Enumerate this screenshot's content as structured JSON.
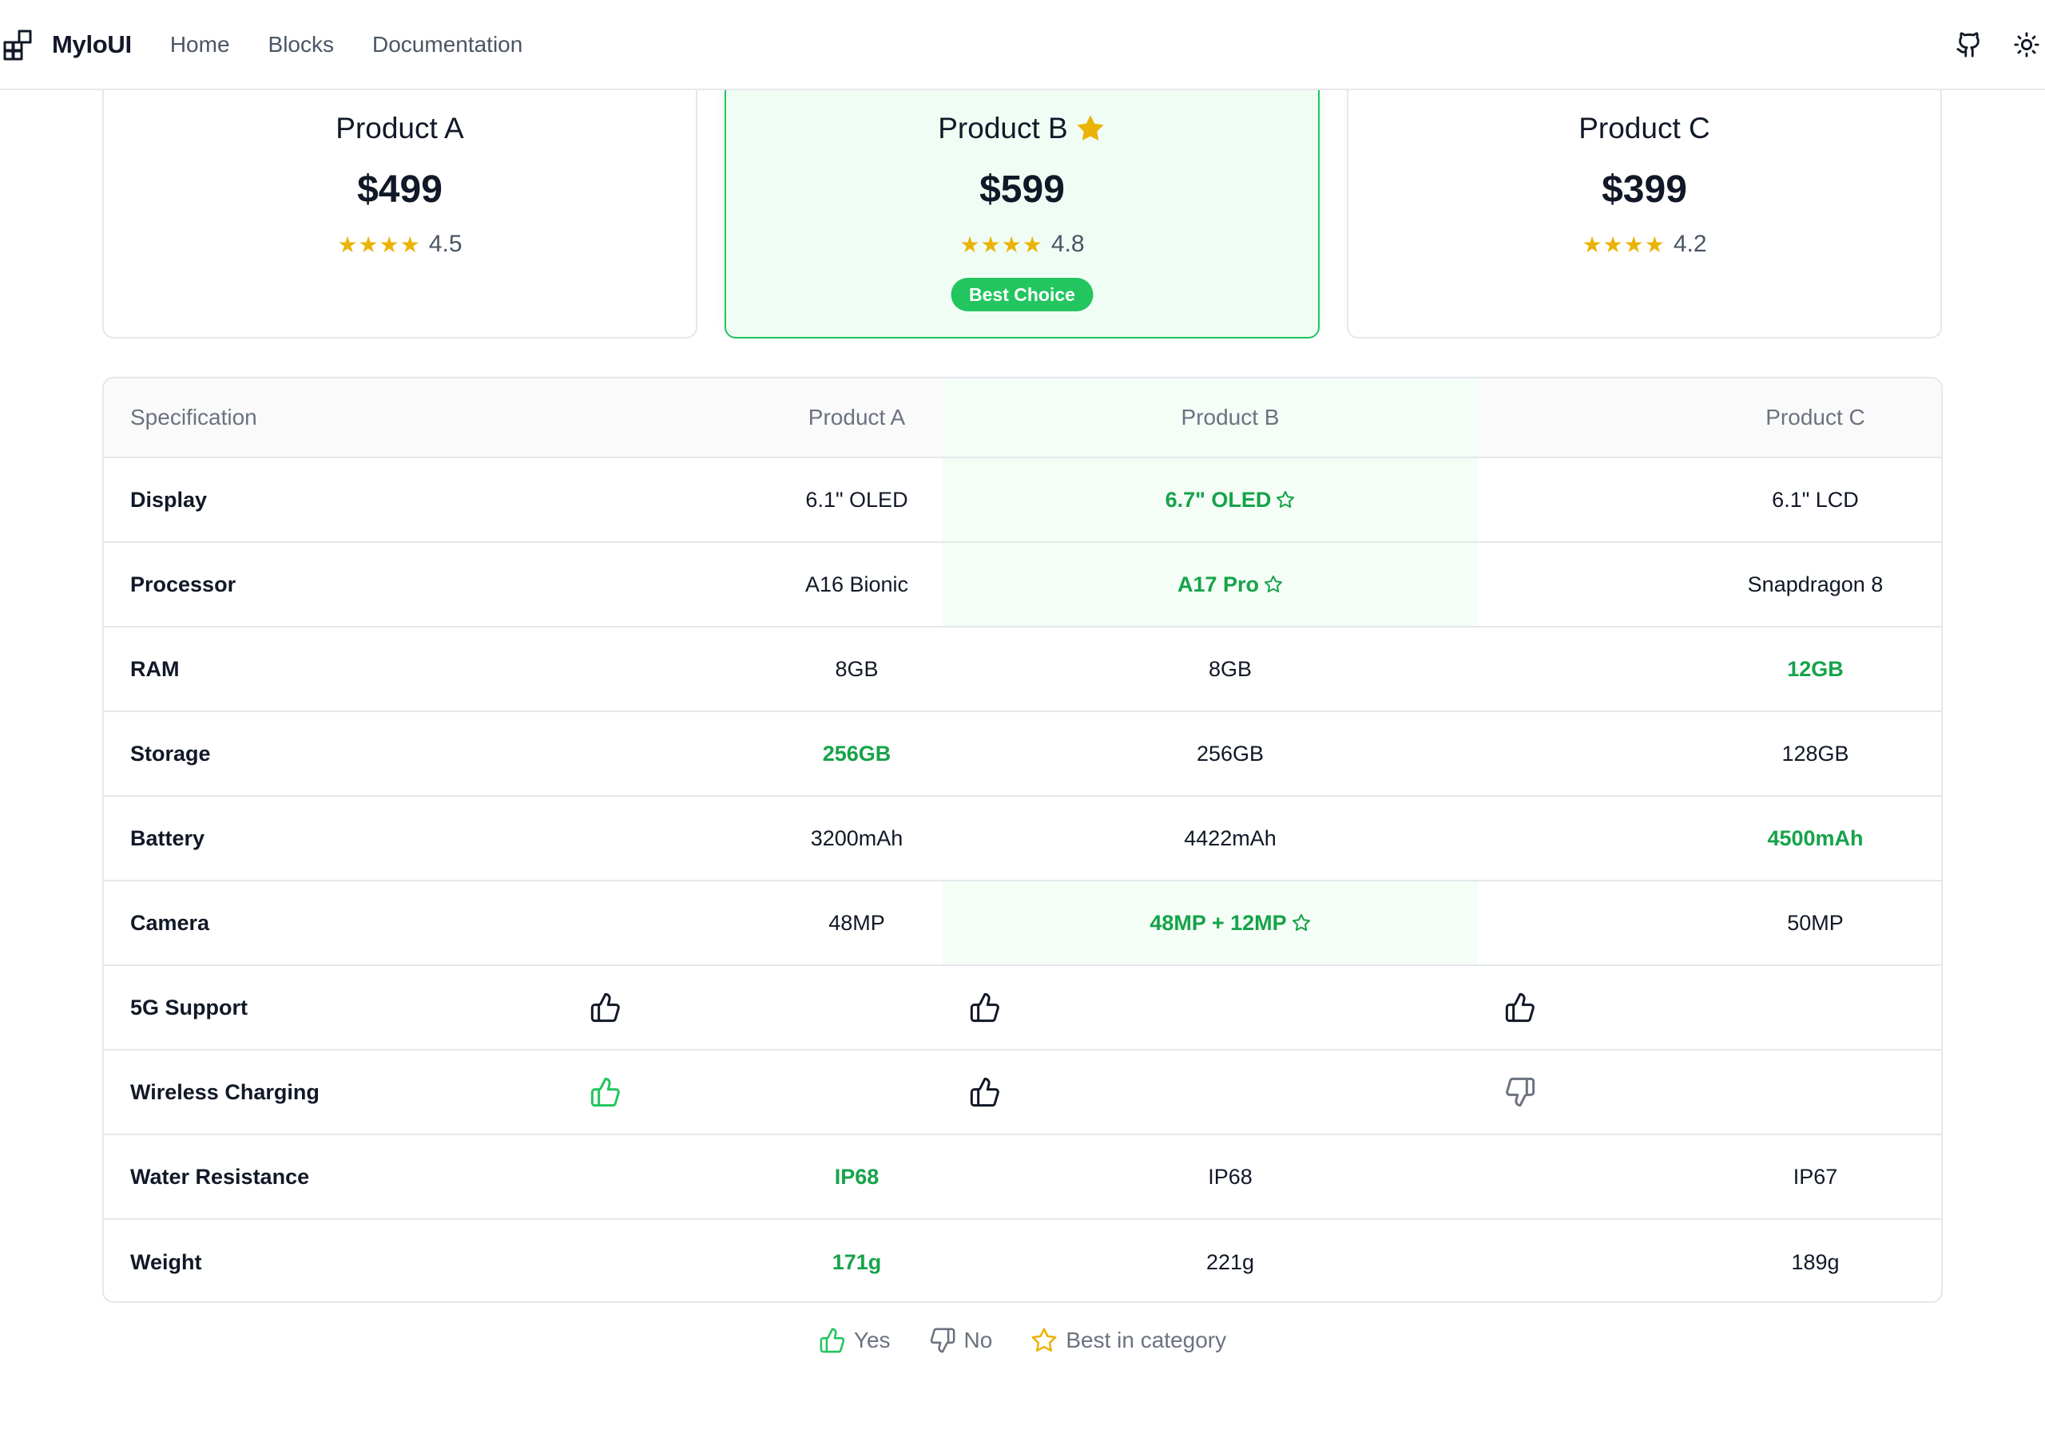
{
  "nav": {
    "brand": "MyloUI",
    "links": [
      "Home",
      "Blocks",
      "Documentation"
    ]
  },
  "colors": {
    "accent": "#22c55e",
    "best_text": "#16a34a",
    "star": "#eab308",
    "featured_bg": "#f0fdf4"
  },
  "products": [
    {
      "name": "Product A",
      "price": "$499",
      "stars": "★★★★",
      "rating": "4.5",
      "featured": false
    },
    {
      "name": "Product B",
      "price": "$599",
      "stars": "★★★★",
      "rating": "4.8",
      "featured": true,
      "badge": "Best Choice"
    },
    {
      "name": "Product C",
      "price": "$399",
      "stars": "★★★★",
      "rating": "4.2",
      "featured": false
    }
  ],
  "table": {
    "headers": [
      "Specification",
      "Product A",
      "Product B",
      "Product C"
    ],
    "rows": [
      {
        "spec": "Display",
        "a": "6.1\" OLED",
        "b": "6.7\" OLED",
        "c": "6.1\" LCD",
        "best": "b",
        "star": true
      },
      {
        "spec": "Processor",
        "a": "A16 Bionic",
        "b": "A17 Pro",
        "c": "Snapdragon 8",
        "best": "b",
        "star": true
      },
      {
        "spec": "RAM",
        "a": "8GB",
        "b": "8GB",
        "c": "12GB",
        "best": "c",
        "star": false
      },
      {
        "spec": "Storage",
        "a": "256GB",
        "b": "256GB",
        "c": "128GB",
        "best": "a",
        "star": false
      },
      {
        "spec": "Battery",
        "a": "3200mAh",
        "b": "4422mAh",
        "c": "4500mAh",
        "best": "c",
        "star": false
      },
      {
        "spec": "Camera",
        "a": "48MP",
        "b": "48MP + 12MP",
        "c": "50MP",
        "best": "b",
        "star": true
      },
      {
        "spec": "5G Support",
        "a": "yes",
        "b": "yes",
        "c": "yes",
        "type": "bool",
        "best": null
      },
      {
        "spec": "Wireless Charging",
        "a": "yes",
        "b": "yes",
        "c": "no",
        "type": "bool",
        "best": "a"
      },
      {
        "spec": "Water Resistance",
        "a": "IP68",
        "b": "IP68",
        "c": "IP67",
        "best": "a",
        "star": false
      },
      {
        "spec": "Weight",
        "a": "171g",
        "b": "221g",
        "c": "189g",
        "best": "a",
        "star": false
      }
    ]
  },
  "legend": {
    "yes": "Yes",
    "no": "No",
    "best": "Best in category"
  }
}
